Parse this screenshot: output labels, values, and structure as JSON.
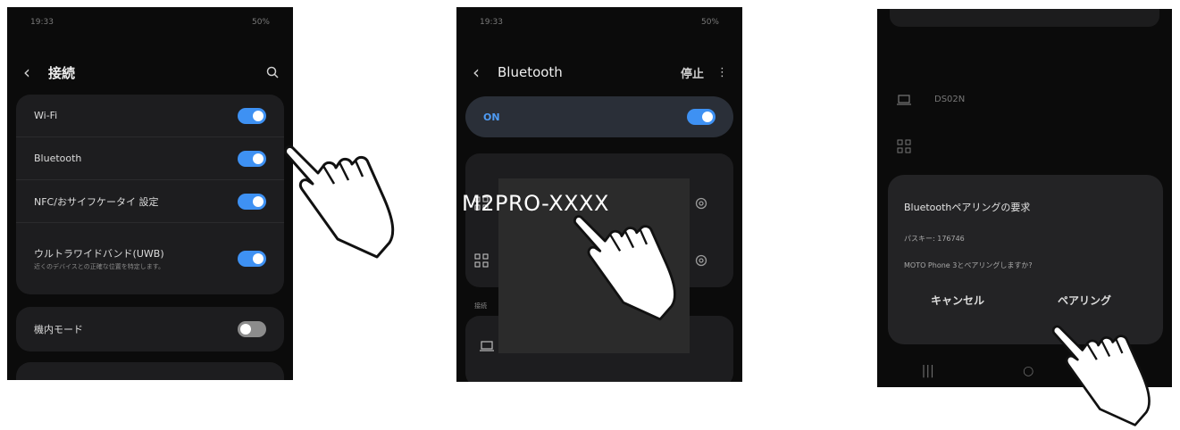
{
  "panel1": {
    "status_left": "19:33",
    "status_right": "50%",
    "title": "接続",
    "rows": [
      {
        "label": "Wi-Fi",
        "toggle": "on"
      },
      {
        "label": "Bluetooth",
        "toggle": "on"
      },
      {
        "label": "NFC/おサイフケータイ 設定",
        "toggle": "on"
      },
      {
        "label": "ウルトラワイドバンド(UWB)",
        "sublabel": "近くのデバイスとの正確な位置を特定します。",
        "toggle": "on"
      },
      {
        "label": "機内モード",
        "toggle": "off"
      }
    ]
  },
  "panel2": {
    "status_left": "19:33",
    "status_right": "50%",
    "title": "Bluetooth",
    "stop_label": "停止",
    "on_label": "ON",
    "section_label": "接続",
    "device_name": "M2PRO-XXXX"
  },
  "panel3": {
    "dialog_title": "Bluetoothペアリングの要求",
    "passkey_line": "パスキー: 176746",
    "question_line": "MOTO Phone 3とペアリングしますか?",
    "cancel_label": "キャンセル",
    "pair_label": "ペアリング",
    "bg_device": "DS02N"
  },
  "colors": {
    "accent": "#3e91f3",
    "bg": "#0b0b0b",
    "card": "#1d1d1f"
  },
  "icons": [
    "back-arrow-icon",
    "search-icon",
    "more-icon",
    "gear-icon",
    "laptop-icon",
    "device-grid-icon",
    "pointing-hand-icon"
  ]
}
